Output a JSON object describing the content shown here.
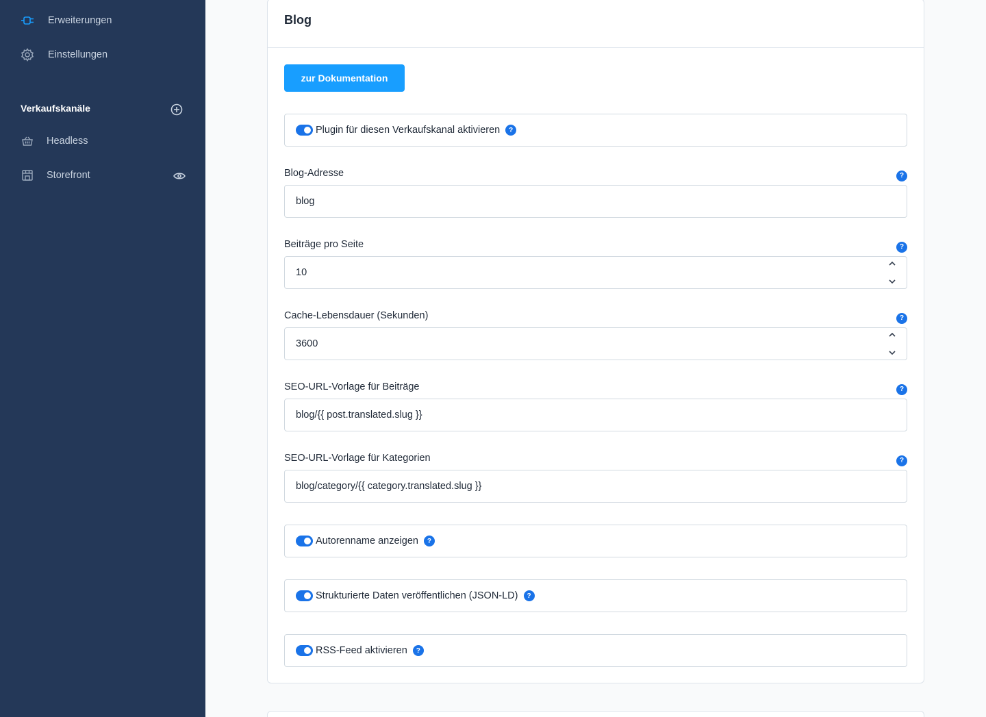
{
  "sidebar": {
    "extensions_label": "Erweiterungen",
    "settings_label": "Einstellungen",
    "sales_channels_heading": "Verkaufskanäle",
    "channels": [
      {
        "label": "Headless"
      },
      {
        "label": "Storefront"
      }
    ]
  },
  "card": {
    "title": "Blog",
    "doc_button": "zur Dokumentation",
    "plugin_toggle": {
      "label": "Plugin für diesen Verkaufskanal aktivieren",
      "checked": true
    },
    "fields": [
      {
        "label": "Blog-Adresse",
        "value": "blog"
      },
      {
        "label": "Beiträge pro Seite",
        "value": "10"
      },
      {
        "label": "Cache-Lebensdauer (Sekunden)",
        "value": "3600"
      },
      {
        "label": "SEO-URL-Vorlage für Beiträge",
        "value": "blog/{{ post.translated.slug }}"
      },
      {
        "label": "SEO-URL-Vorlage für Kategorien",
        "value": "blog/category/{{ category.translated.slug }}"
      }
    ],
    "toggles": [
      {
        "label": "Autorenname anzeigen",
        "checked": true
      },
      {
        "label": "Strukturierte Daten veröffentlichen (JSON-LD)",
        "checked": true
      },
      {
        "label": "RSS-Feed aktivieren",
        "checked": true
      }
    ],
    "help_glyph": "?"
  },
  "colors": {
    "sidebar_bg": "#243858",
    "primary_button": "#189eff",
    "toggle_on": "#1a73e8",
    "extensions_icon": "#189eff"
  }
}
